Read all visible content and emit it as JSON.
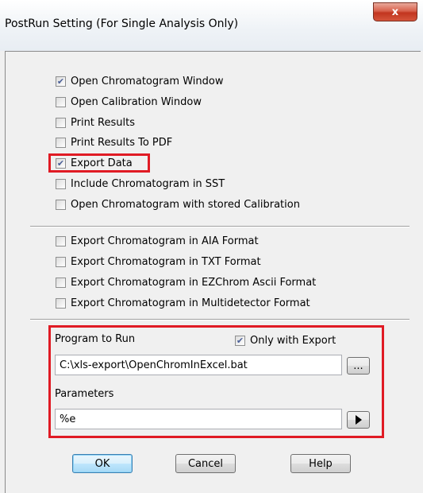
{
  "window": {
    "title": "PostRun Setting (For Single Analysis Only)",
    "close_label": "x"
  },
  "options_group1": [
    {
      "label": "Open Chromatogram Window",
      "checked": true
    },
    {
      "label": "Open Calibration Window",
      "checked": false
    },
    {
      "label": "Print Results",
      "checked": false
    },
    {
      "label": "Print Results To PDF",
      "checked": false
    },
    {
      "label": "Export Data",
      "checked": true
    },
    {
      "label": "Include Chromatogram in SST",
      "checked": false
    },
    {
      "label": "Open Chromatogram with stored Calibration",
      "checked": false
    }
  ],
  "options_group2": [
    {
      "label": "Export Chromatogram in AIA Format",
      "checked": false
    },
    {
      "label": "Export Chromatogram in TXT Format",
      "checked": false
    },
    {
      "label": "Export Chromatogram in EZChrom Ascii Format",
      "checked": false
    },
    {
      "label": "Export Chromatogram in Multidetector Format",
      "checked": false
    }
  ],
  "program": {
    "label": "Program to Run",
    "only_with_export_label": "Only with Export",
    "only_with_export_checked": true,
    "path": "C:\\xls-export\\OpenChromInExcel.bat",
    "browse_label": "...",
    "parameters_label": "Parameters",
    "parameters_value": "%e",
    "arrow_icon": "play-arrow-icon"
  },
  "buttons": {
    "ok": "OK",
    "cancel": "Cancel",
    "help": "Help"
  },
  "colors": {
    "highlight": "#e01b24",
    "check": "#4a5f97"
  }
}
